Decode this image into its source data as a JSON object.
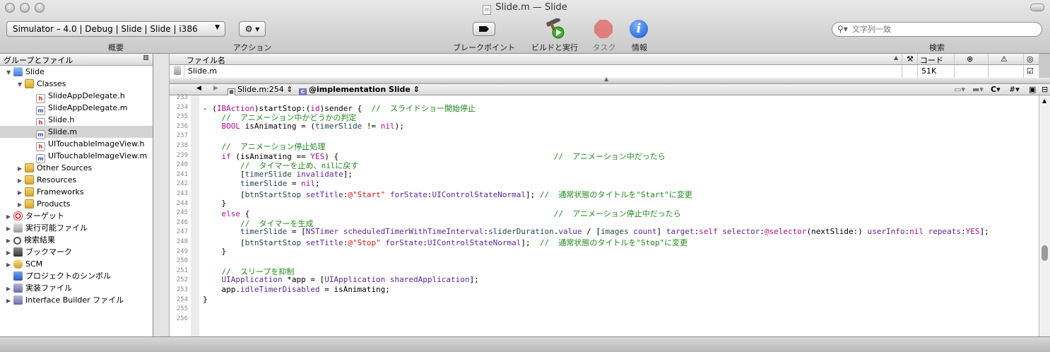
{
  "window": {
    "title": "Slide.m — Slide"
  },
  "toolbar": {
    "scheme_value": "Simulator – 4.0 | Debug | Slide | Slide | i386",
    "scheme_label": "概要",
    "action_label": "アクション",
    "breakpoints_label": "ブレークポイント",
    "build_label": "ビルドと実行",
    "tasks_label": "タスク",
    "info_label": "情報",
    "search_placeholder": "文字列一致",
    "search_label": "検索"
  },
  "sidebar": {
    "header": "グループとファイル",
    "items": [
      {
        "label": "Slide",
        "icon": "project-icon",
        "level": 0,
        "disc": "▼"
      },
      {
        "label": "Classes",
        "icon": "folder-icon",
        "level": 1,
        "disc": "▼"
      },
      {
        "label": "SlideAppDelegate.h",
        "icon": "header-file-icon",
        "level": 2,
        "disc": ""
      },
      {
        "label": "SlideAppDelegate.m",
        "icon": "m-file-icon",
        "level": 2,
        "disc": ""
      },
      {
        "label": "Slide.h",
        "icon": "header-file-icon",
        "level": 2,
        "disc": ""
      },
      {
        "label": "Slide.m",
        "icon": "m-file-icon",
        "level": 2,
        "disc": "",
        "selected": true
      },
      {
        "label": "UITouchableImageView.h",
        "icon": "header-file-icon",
        "level": 2,
        "disc": ""
      },
      {
        "label": "UITouchableImageView.m",
        "icon": "m-file-icon",
        "level": 2,
        "disc": ""
      },
      {
        "label": "Other Sources",
        "icon": "folder-icon",
        "level": 1,
        "disc": "▶"
      },
      {
        "label": "Resources",
        "icon": "folder-icon",
        "level": 1,
        "disc": "▶"
      },
      {
        "label": "Frameworks",
        "icon": "folder-icon",
        "level": 1,
        "disc": "▶"
      },
      {
        "label": "Products",
        "icon": "folder-icon",
        "level": 1,
        "disc": "▶"
      },
      {
        "label": "ターゲット",
        "icon": "target-icon",
        "level": 0,
        "disc": "▶"
      },
      {
        "label": "実行可能ファイル",
        "icon": "executable-icon",
        "level": 0,
        "disc": "▶"
      },
      {
        "label": "検索結果",
        "icon": "search-results-icon",
        "level": 0,
        "disc": "▶"
      },
      {
        "label": "ブックマーク",
        "icon": "bookmark-icon",
        "level": 0,
        "disc": "▶"
      },
      {
        "label": "SCM",
        "icon": "scm-icon",
        "level": 0,
        "disc": "▶"
      },
      {
        "label": "プロジェクトのシンボル",
        "icon": "symbols-icon",
        "level": 0,
        "disc": ""
      },
      {
        "label": "実装ファイル",
        "icon": "implementation-files-icon",
        "level": 0,
        "disc": "▶"
      },
      {
        "label": "Interface Builder ファイル",
        "icon": "ib-files-icon",
        "level": 0,
        "disc": "▶"
      }
    ]
  },
  "file_list": {
    "columns": {
      "name": "ファイル名",
      "code": "コード"
    },
    "rows": [
      {
        "name": "Slide.m",
        "code": "51K"
      }
    ]
  },
  "navbar": {
    "file_position": "Slide.m:254",
    "symbol": "@implementation Slide"
  },
  "editor": {
    "lines": [
      {
        "n": "233",
        "html": ""
      },
      {
        "n": "234",
        "html": "- (<span class=\"kw\">IBAction</span>)startStop:(<span class=\"kw\">id</span>)sender {  <span class=\"cmt\">//  スライドショー開始停止</span>"
      },
      {
        "n": "235",
        "html": "    <span class=\"cmt\">//  アニメーション中かどうかの判定</span>"
      },
      {
        "n": "236",
        "html": "    <span class=\"kw\">BOOL</span> isAnimating = (<span class=\"mth\">timerSlide</span> != <span class=\"kw\">nil</span>);"
      },
      {
        "n": "237",
        "html": ""
      },
      {
        "n": "238",
        "html": "    <span class=\"cmt\">//  アニメーション停止処理</span>"
      },
      {
        "n": "239",
        "html": "    <span class=\"kw\">if</span> (isAnimating == <span class=\"kw\">YES</span>) {                                              <span class=\"cmt\">//  アニメーション中だったら</span>"
      },
      {
        "n": "240",
        "html": "        <span class=\"cmt\">//  タイマーを止め、nilに戻す</span>"
      },
      {
        "n": "241",
        "html": "        [<span class=\"mth\">timerSlide</span> <span class=\"cls\">invalidate</span>];"
      },
      {
        "n": "242",
        "html": "        <span class=\"mth\">timerSlide</span> = <span class=\"kw\">nil</span>;"
      },
      {
        "n": "243",
        "html": "        [<span class=\"mth\">btnStartStop</span> <span class=\"cls\">setTitle</span>:<span class=\"str\">@\"Start\"</span> <span class=\"cls\">forState</span>:<span class=\"cls\">UIControlStateNormal</span>]; <span class=\"cmt\">//  通常状態のタイトルを\"Start\"に変更</span>"
      },
      {
        "n": "244",
        "html": "    }"
      },
      {
        "n": "245",
        "html": "    <span class=\"kw\">else</span> {                                                                 <span class=\"cmt\">//  アニメーション停止中だったら</span>"
      },
      {
        "n": "246",
        "html": "        <span class=\"cmt\">//  タイマーを生成</span>"
      },
      {
        "n": "247",
        "html": "        <span class=\"mth\">timerSlide</span> = [<span class=\"cls\">NSTimer</span> <span class=\"cls\">scheduledTimerWithTimeInterval</span>:<span class=\"mth\">sliderDuration</span>.<span class=\"cls\">value</span> / [<span class=\"mth\">images</span> <span class=\"cls\">count</span>] <span class=\"cls\">target</span>:<span class=\"kw\">self</span> <span class=\"cls\">selector</span>:<span class=\"kw\">@selector</span>(nextSlide:) <span class=\"cls\">userInfo</span>:<span class=\"kw\">nil</span> <span class=\"cls\">repeats</span>:<span class=\"kw\">YES</span>];"
      },
      {
        "n": "248",
        "html": "        [<span class=\"mth\">btnStartStop</span> <span class=\"cls\">setTitle</span>:<span class=\"str\">@\"Stop\"</span> <span class=\"cls\">forState</span>:<span class=\"cls\">UIControlStateNormal</span>];  <span class=\"cmt\">//  通常状態のタイトルを\"Stop\"に変更</span>"
      },
      {
        "n": "249",
        "html": "    }"
      },
      {
        "n": "250",
        "html": ""
      },
      {
        "n": "251",
        "html": "    <span class=\"cmt\">//  スリープを抑制</span>"
      },
      {
        "n": "252",
        "html": "    <span class=\"cls\">UIApplication</span> *app = [<span class=\"cls\">UIApplication</span> <span class=\"cls\">sharedApplication</span>];"
      },
      {
        "n": "253",
        "html": "    app.<span class=\"cls\">idleTimerDisabled</span> = isAnimating;"
      },
      {
        "n": "254",
        "html": "}"
      },
      {
        "n": "255",
        "html": ""
      },
      {
        "n": "256",
        "html": ""
      }
    ]
  }
}
